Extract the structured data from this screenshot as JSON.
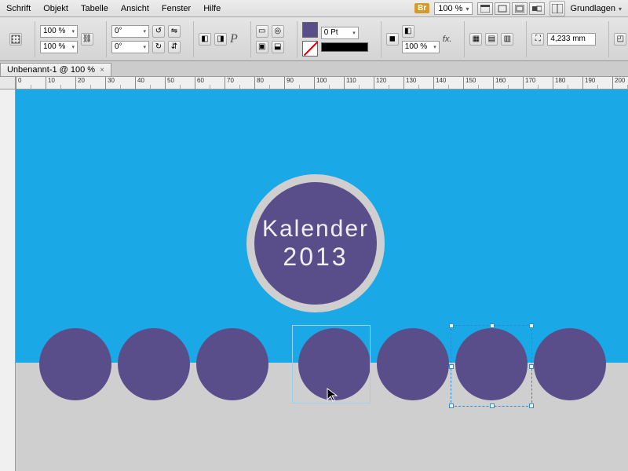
{
  "menu": {
    "items": [
      "Schrift",
      "Objekt",
      "Tabelle",
      "Ansicht",
      "Fenster",
      "Hilfe"
    ],
    "br": "Br",
    "zoom": "100 %",
    "workspace": "Grundlagen"
  },
  "control": {
    "opacity_a": "100 %",
    "opacity_b": "100 %",
    "angle_a": "0°",
    "angle_b": "0°",
    "stroke_weight": "0 Pt",
    "stroke_opacity": "100 %",
    "fx": "fx.",
    "measure": "4,233 mm"
  },
  "tab": {
    "label": "Unbenannt-1 @ 100 %",
    "close": "×"
  },
  "ruler_ticks": [
    0,
    10,
    20,
    30,
    40,
    50,
    60,
    70,
    80,
    90,
    100,
    110,
    120,
    130,
    140,
    150,
    160,
    170,
    180,
    190,
    200
  ],
  "artwork": {
    "title_line1": "Kalender",
    "title_line2": "2013",
    "dots": [
      30,
      130,
      230,
      360,
      460,
      560,
      660
    ]
  }
}
